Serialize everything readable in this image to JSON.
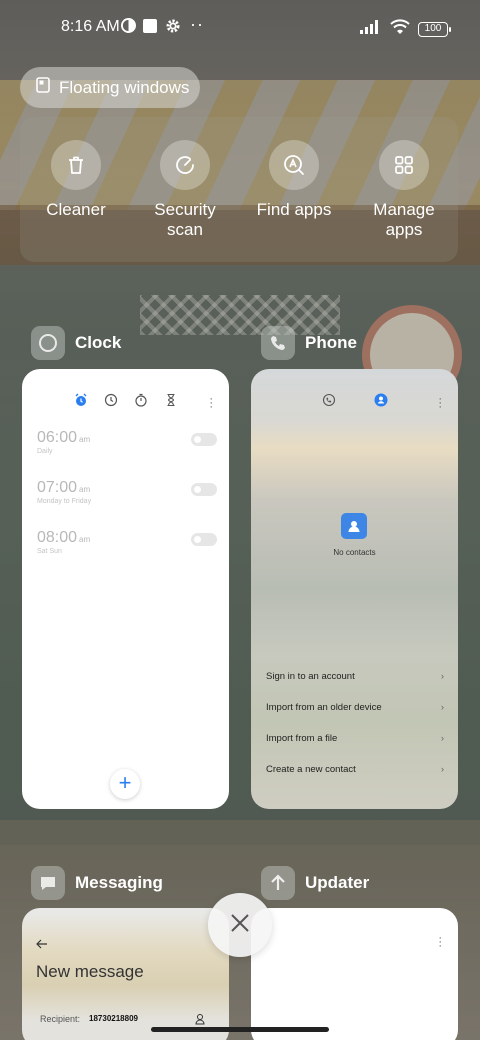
{
  "status_bar": {
    "time": "8:16 AM",
    "battery": "100",
    "icons": [
      "data-saver-icon",
      "notification-square-icon",
      "gear-icon",
      "more-dots-icon",
      "signal-icon",
      "wifi-icon",
      "battery-icon"
    ]
  },
  "floating_windows": {
    "label": "Floating windows",
    "icon": "floating-window-icon"
  },
  "quick_actions": [
    {
      "label": "Cleaner",
      "icon": "trash-icon"
    },
    {
      "label": "Security\nscan",
      "icon": "security-scan-icon"
    },
    {
      "label": "Find apps",
      "icon": "find-apps-icon"
    },
    {
      "label": "Manage\napps",
      "icon": "grid-icon"
    }
  ],
  "apps": {
    "clock": {
      "name": "Clock",
      "tabs": [
        "alarm-icon",
        "clock-icon",
        "stopwatch-icon",
        "timer-icon"
      ],
      "alarms": [
        {
          "time": "06:00",
          "ampm": "am",
          "repeat": "Daily"
        },
        {
          "time": "07:00",
          "ampm": "am",
          "repeat": "Monday to Friday"
        },
        {
          "time": "08:00",
          "ampm": "am",
          "repeat": "Sat Sun"
        }
      ],
      "fab": "+"
    },
    "phone": {
      "name": "Phone",
      "empty_label": "No contacts",
      "options": [
        "Sign in to an account",
        "Import from an older device",
        "Import from a file",
        "Create a new contact"
      ],
      "chevron": "›"
    },
    "messaging": {
      "name": "Messaging",
      "title": "New message",
      "recipient_label": "Recipient:",
      "recipient_value": "18730218809"
    },
    "updater": {
      "name": "Updater"
    }
  },
  "colors": {
    "accent": "#2a7ef0"
  }
}
